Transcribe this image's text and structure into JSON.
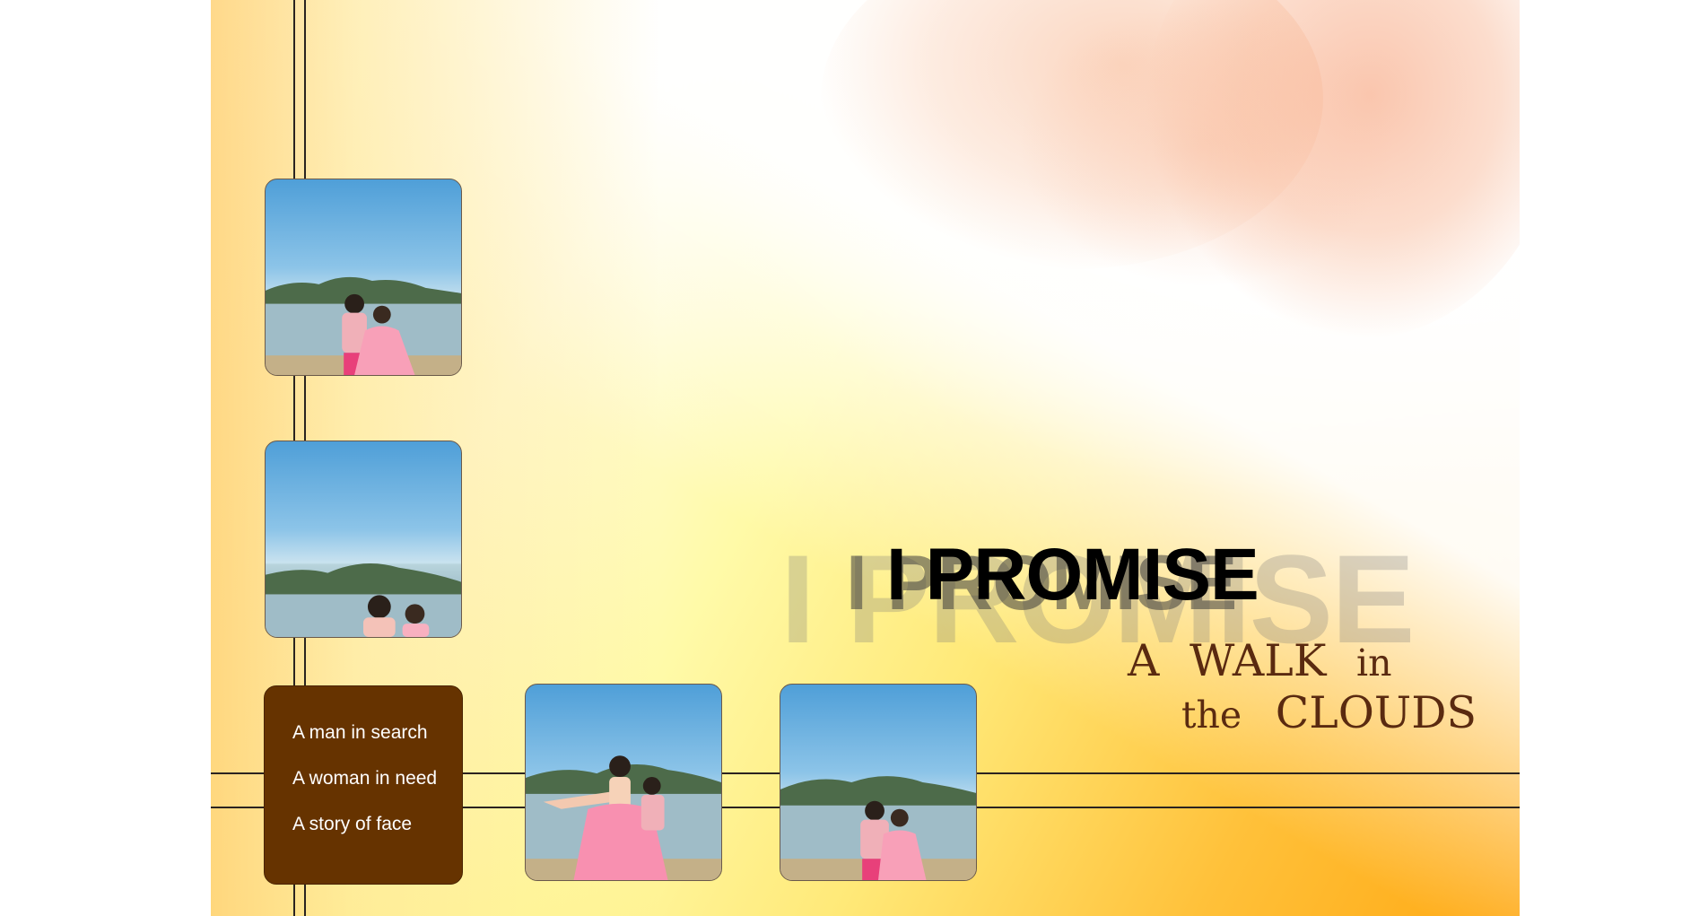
{
  "title": {
    "main": "I PROMISE",
    "subtitle_line1": [
      "A",
      "WALK",
      "in"
    ],
    "subtitle_line2": [
      "the",
      "CLOUDS"
    ]
  },
  "caption_box": {
    "lines": [
      "A man in search",
      "A woman in need",
      "A story of face"
    ]
  },
  "photos": [
    {
      "name": "photo-couple-1",
      "description_icon": "photo"
    },
    {
      "name": "photo-couple-2",
      "description_icon": "photo"
    },
    {
      "name": "photo-couple-3",
      "description_icon": "photo"
    },
    {
      "name": "photo-couple-4",
      "description_icon": "photo"
    }
  ],
  "colors": {
    "caption_box_bg": "#663300",
    "subtitle": "#5a2a10",
    "title": "#000000",
    "background_warm": "#ffa914",
    "accent_pink": "#f7b08f"
  }
}
